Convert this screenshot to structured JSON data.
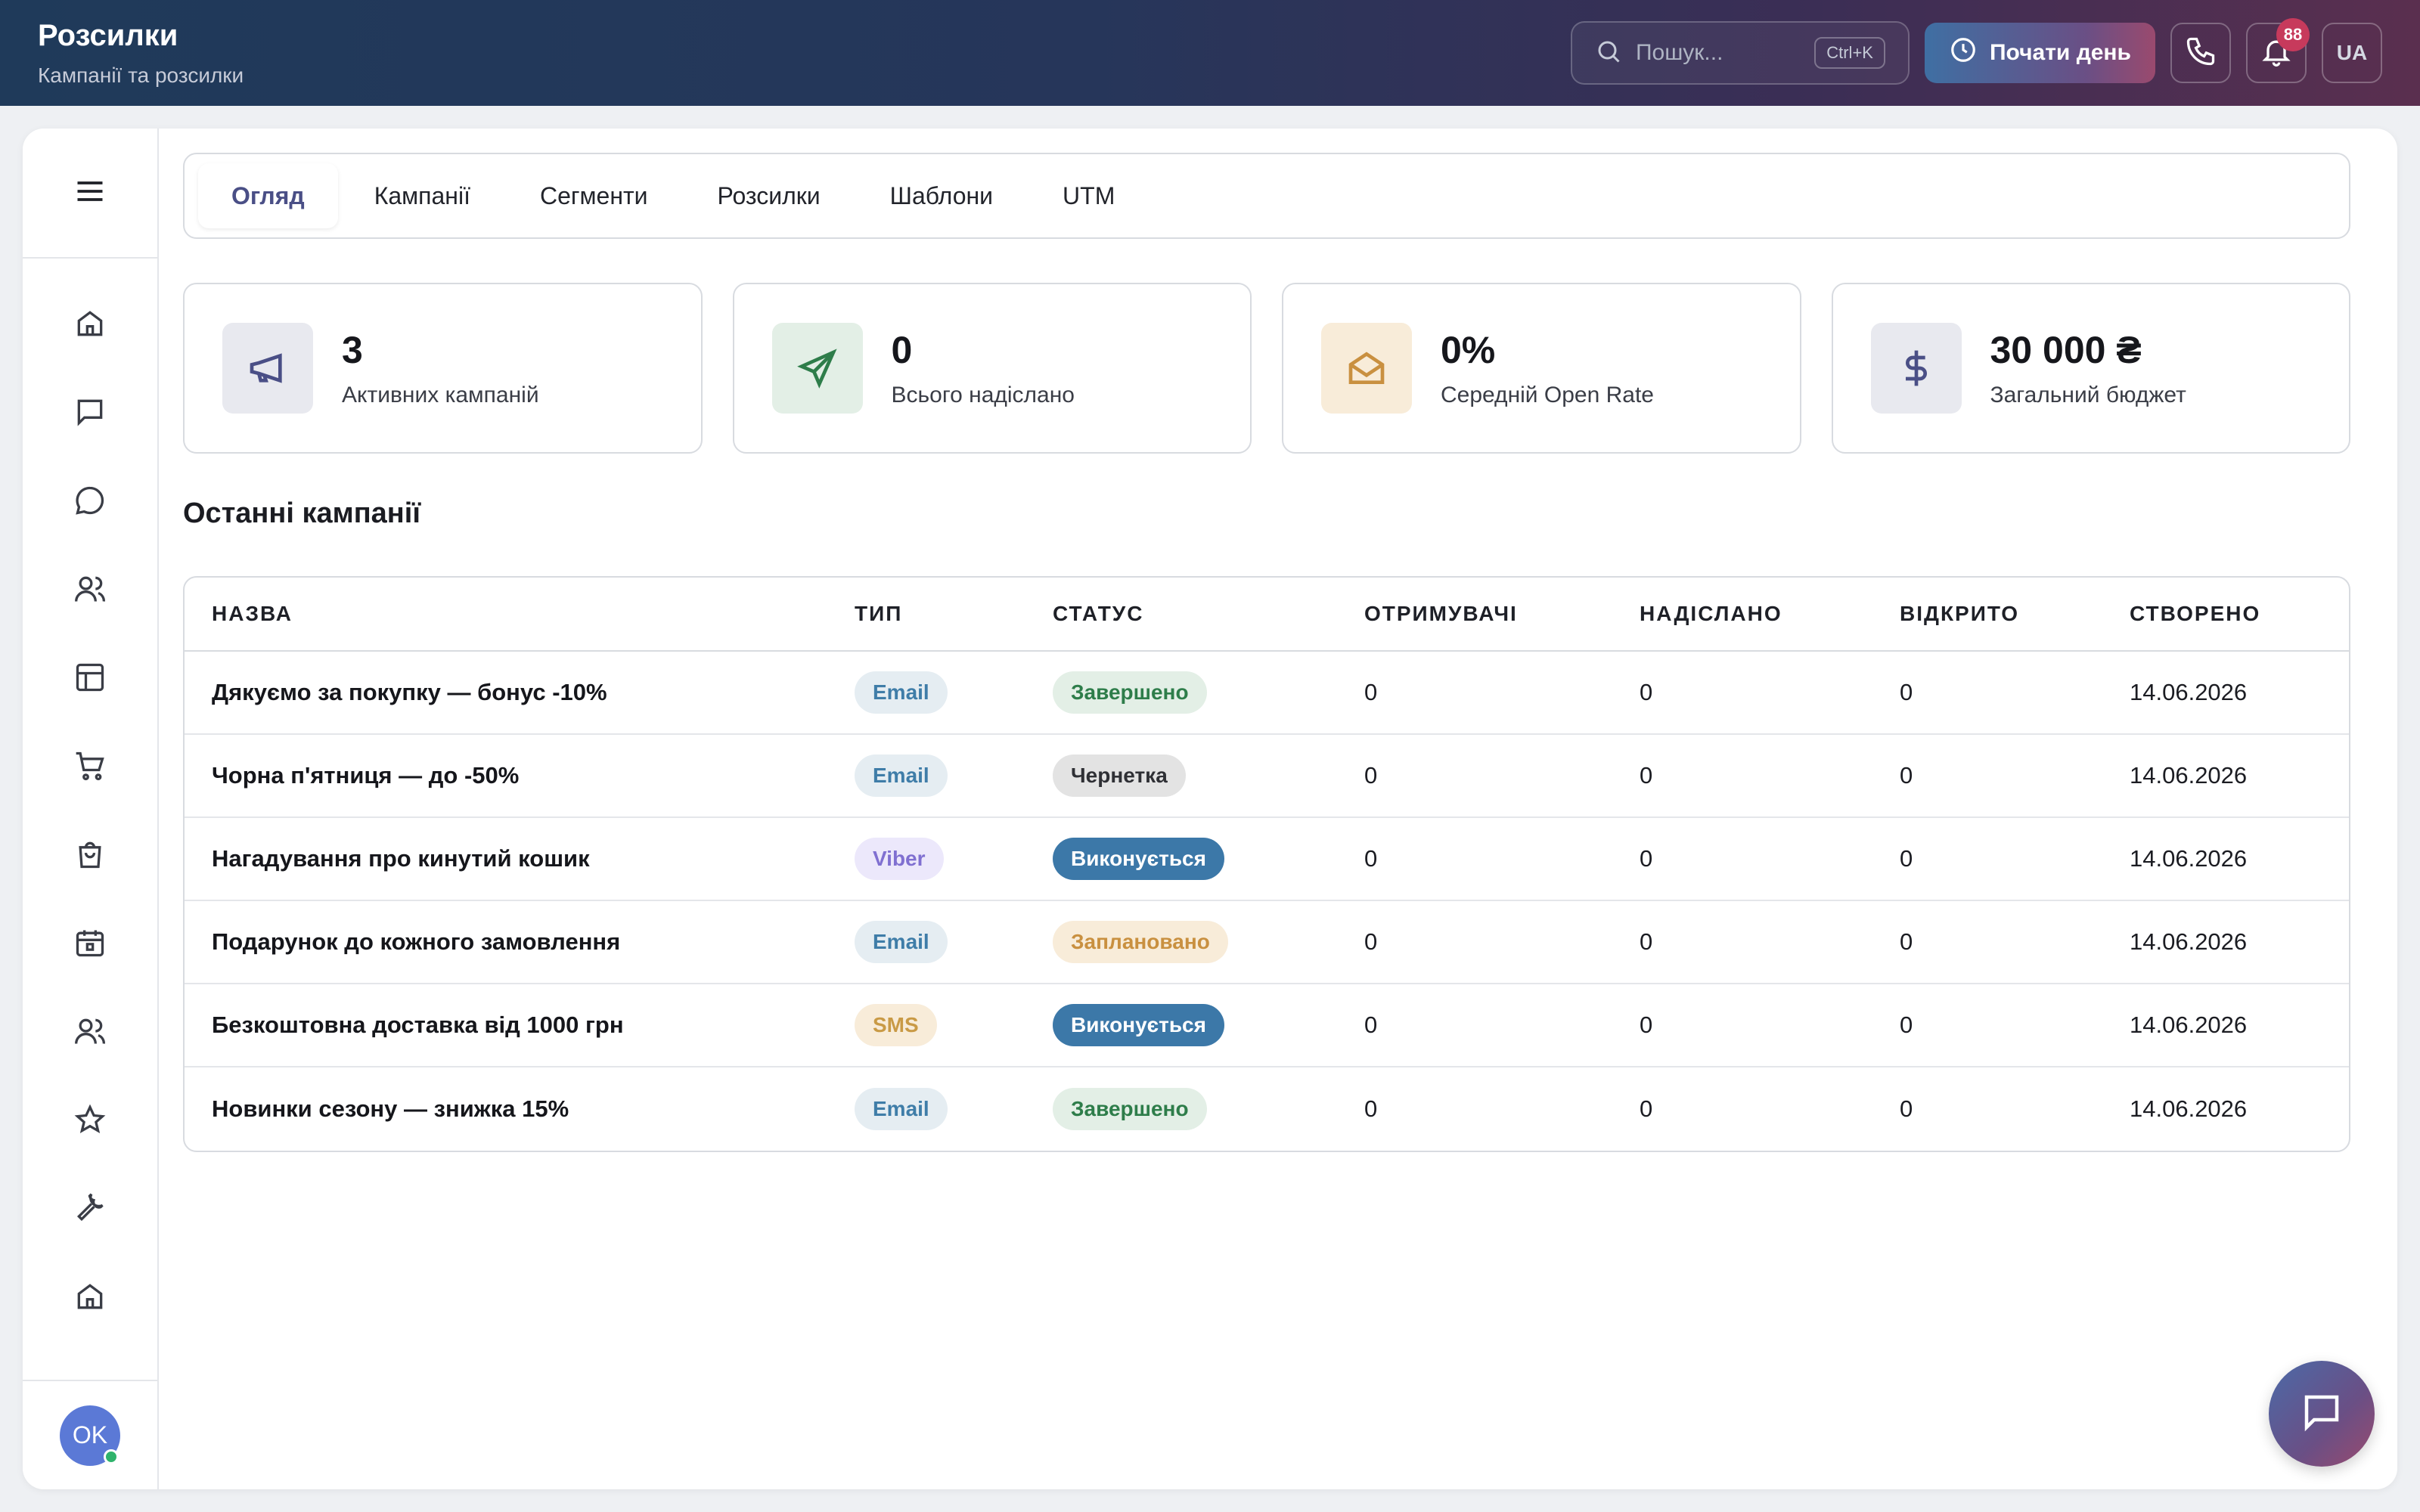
{
  "header": {
    "title": "Розсилки",
    "subtitle": "Кампанії та розсилки",
    "search_placeholder": "Пошук...",
    "search_shortcut": "Ctrl+K",
    "start_day_label": "Почати день",
    "notifications_count": "88",
    "language": "UA"
  },
  "sidebar": {
    "icons": [
      "home-icon",
      "message-square-icon",
      "chat-bubble-icon",
      "users-icon",
      "layout-icon",
      "cart-icon",
      "bag-icon",
      "calendar-icon",
      "team-icon",
      "star-icon",
      "wrench-icon",
      "building-icon"
    ],
    "avatar_initials": "OK"
  },
  "tabs": [
    "Огляд",
    "Кампанії",
    "Сегменти",
    "Розсилки",
    "Шаблони",
    "UTM"
  ],
  "active_tab": 0,
  "stats": [
    {
      "value": "3",
      "label": "Активних кампаній",
      "icon": "megaphone-icon"
    },
    {
      "value": "0",
      "label": "Всього надіслано",
      "icon": "send-icon"
    },
    {
      "value": "0%",
      "label": "Середній Open Rate",
      "icon": "mail-open-icon"
    },
    {
      "value": "30 000 ₴",
      "label": "Загальний бюджет",
      "icon": "dollar-icon"
    }
  ],
  "section_title": "Останні кампанії",
  "table": {
    "headers": [
      "НАЗВА",
      "ТИП",
      "СТАТУС",
      "ОТРИМУВАЧІ",
      "НАДІСЛАНО",
      "ВІДКРИТО",
      "СТВОРЕНО"
    ],
    "rows": [
      {
        "name": "Дякуємо за покупку — бонус -10%",
        "type": "Email",
        "status": "Завершено",
        "recipients": "0",
        "sent": "0",
        "opened": "0",
        "created": "14.06.2026"
      },
      {
        "name": "Чорна п'ятниця — до -50%",
        "type": "Email",
        "status": "Чернетка",
        "recipients": "0",
        "sent": "0",
        "opened": "0",
        "created": "14.06.2026"
      },
      {
        "name": "Нагадування про кинутий кошик",
        "type": "Viber",
        "status": "Виконується",
        "recipients": "0",
        "sent": "0",
        "opened": "0",
        "created": "14.06.2026"
      },
      {
        "name": "Подарунок до кожного замовлення",
        "type": "Email",
        "status": "Заплановано",
        "recipients": "0",
        "sent": "0",
        "opened": "0",
        "created": "14.06.2026"
      },
      {
        "name": "Безкоштовна доставка від 1000 грн",
        "type": "SMS",
        "status": "Виконується",
        "recipients": "0",
        "sent": "0",
        "opened": "0",
        "created": "14.06.2026"
      },
      {
        "name": "Новинки сезону — знижка 15%",
        "type": "Email",
        "status": "Завершено",
        "recipients": "0",
        "sent": "0",
        "opened": "0",
        "created": "14.06.2026"
      }
    ]
  },
  "colors": {
    "accent": "#4a4f86",
    "status_running": "#3c78a8",
    "status_done": "#2e7d4a",
    "status_planned": "#c99040"
  }
}
